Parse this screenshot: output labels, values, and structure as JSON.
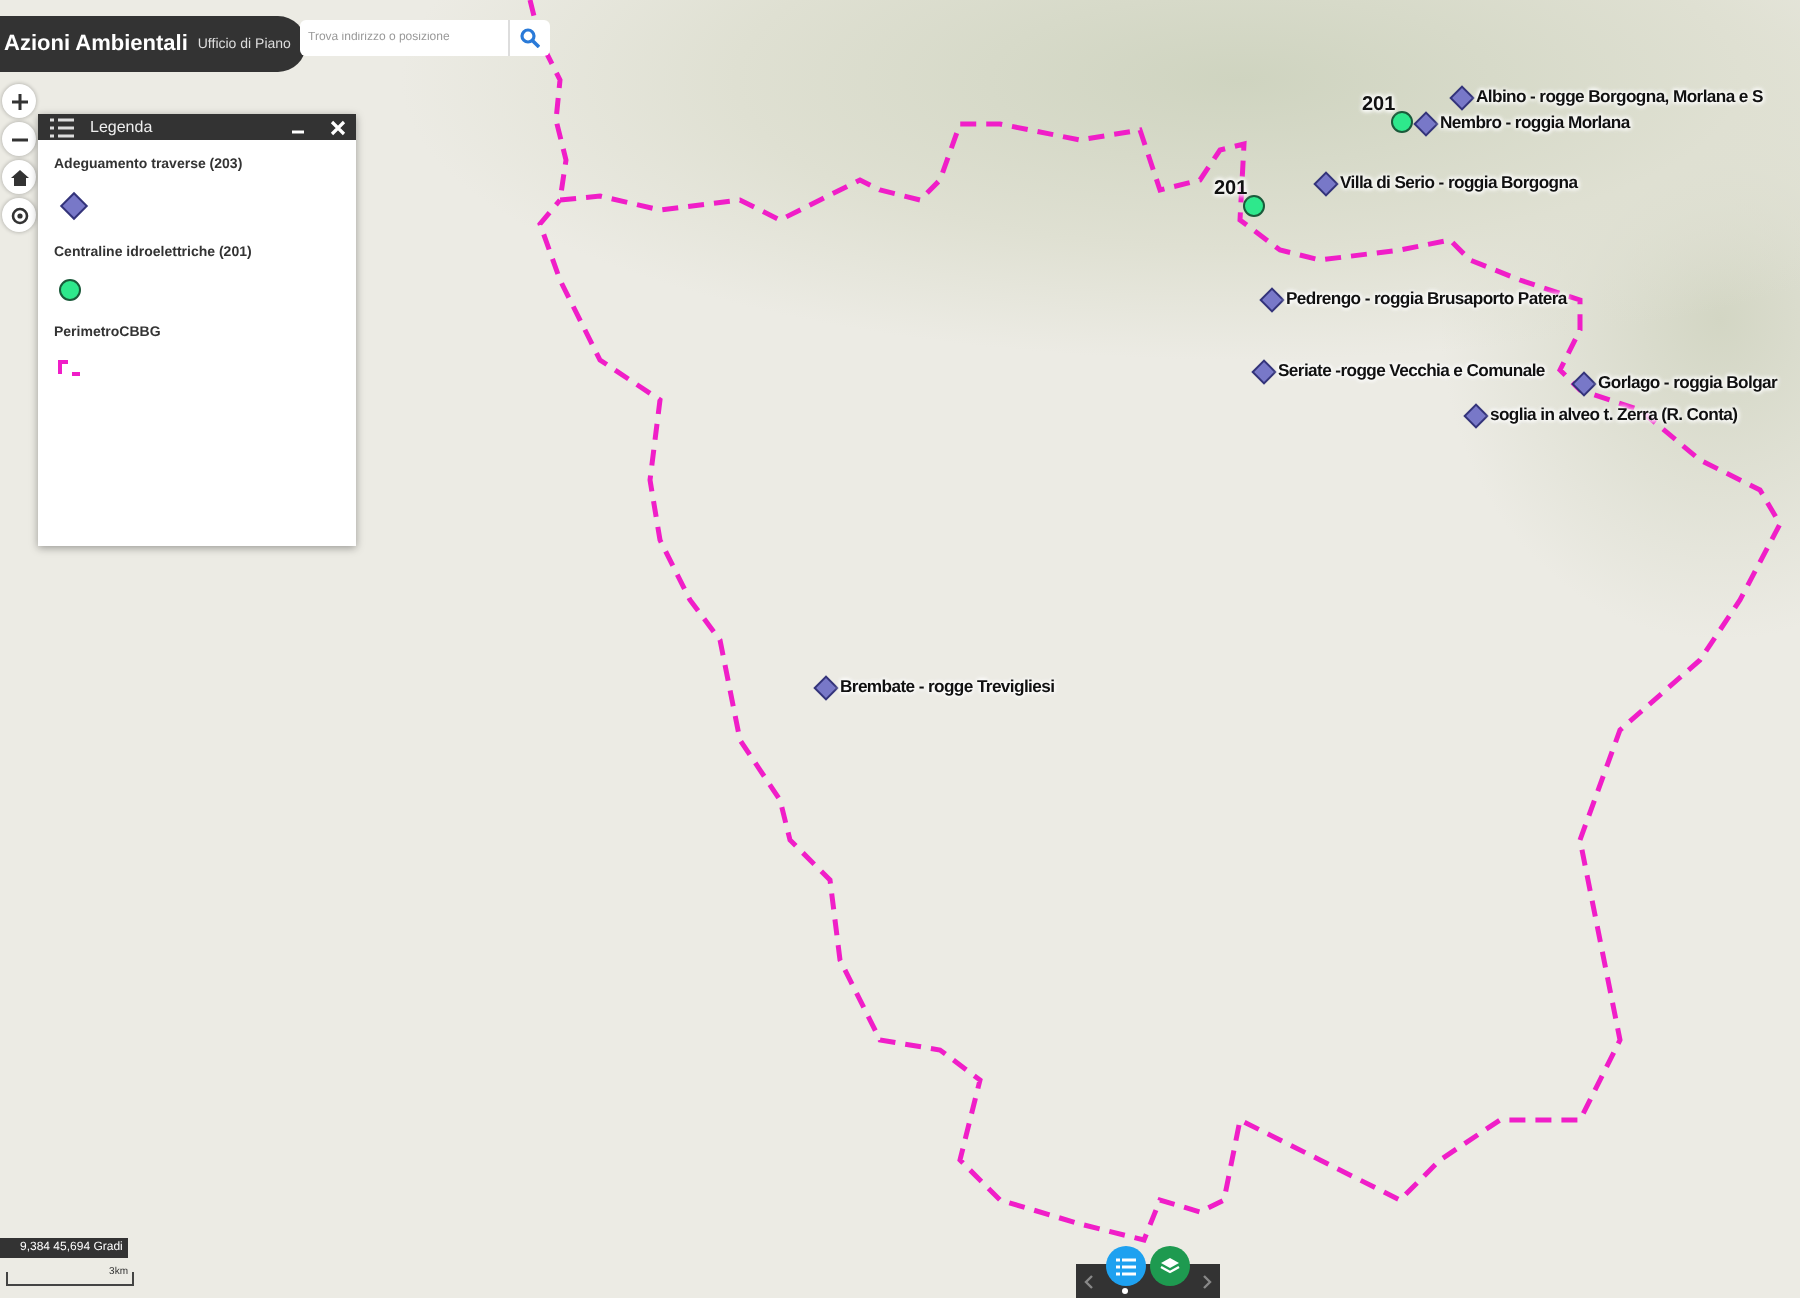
{
  "header": {
    "title": "Azioni Ambientali",
    "subtitle": "Ufficio di Piano"
  },
  "search": {
    "placeholder": "Trova indirizzo o posizione"
  },
  "legend": {
    "title": "Legenda",
    "layers": [
      {
        "label": "Adeguamento traverse (203)",
        "kind": "diamond"
      },
      {
        "label": "Centraline idroelettriche (201)",
        "kind": "circle"
      },
      {
        "label": "PerimetroCBBG",
        "kind": "line"
      }
    ]
  },
  "markers": [
    {
      "kind": "diamond",
      "label": "Albino - rogge Borgogna, Morlana e S"
    },
    {
      "kind": "diamond",
      "label": "Nembro - roggia Morlana"
    },
    {
      "kind": "circle",
      "label": "201"
    },
    {
      "kind": "circle",
      "label": "201"
    },
    {
      "kind": "diamond",
      "label": "Villa di Serio - roggia Borgogna"
    },
    {
      "kind": "diamond",
      "label": "Pedrengo - roggia Brusaporto Patera"
    },
    {
      "kind": "diamond",
      "label": "Seriate -rogge Vecchia e Comunale"
    },
    {
      "kind": "diamond",
      "label": "Gorlago - roggia Bolgar"
    },
    {
      "kind": "diamond",
      "label": "soglia in alveo t. Zerra (R. Conta)"
    },
    {
      "kind": "diamond",
      "label": "Brembate - rogge Trevigliesi"
    }
  ],
  "coordinates": "9,384 45,694 Gradi",
  "scale": "3km"
}
